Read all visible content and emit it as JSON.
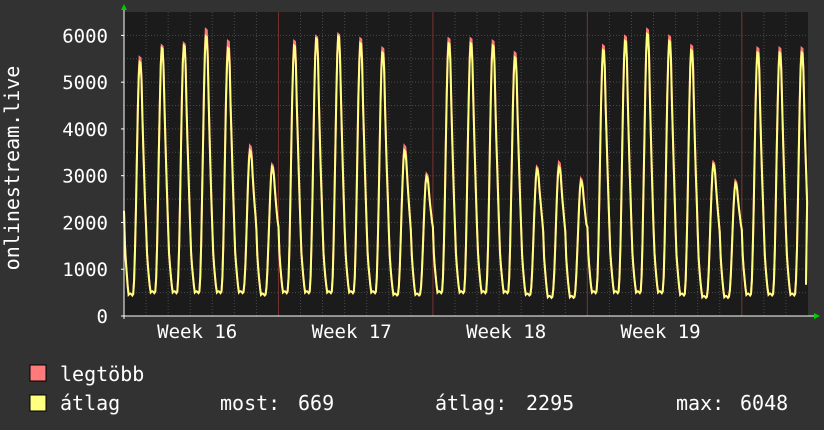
{
  "chart_data": {
    "type": "line",
    "ylabel": "onlinestream.live",
    "ylim": [
      0,
      6500
    ],
    "yticks": [
      0,
      1000,
      2000,
      3000,
      4000,
      5000,
      6000
    ],
    "week_labels": [
      "Week 16",
      "Week 17",
      "Week 18",
      "Week 19"
    ],
    "grid": true,
    "days": 31,
    "daily_peaks_max": [
      5550,
      5800,
      5850,
      6150,
      5900,
      3650,
      3250,
      5900,
      6000,
      6050,
      5950,
      5750,
      3650,
      3050,
      5950,
      5950,
      5900,
      5650,
      3200,
      3300,
      2950,
      5800,
      6000,
      6150,
      6000,
      5800,
      3300,
      2900,
      5750,
      5750
    ],
    "daily_peaks_avg": [
      5450,
      5750,
      5800,
      6000,
      5750,
      3550,
      3200,
      5800,
      5950,
      6000,
      5850,
      5650,
      3550,
      3000,
      5850,
      5850,
      5800,
      5550,
      3150,
      3200,
      2900,
      5700,
      5900,
      6050,
      5900,
      5700,
      3250,
      2850,
      5650,
      5650
    ],
    "daily_troughs": [
      450,
      500,
      500,
      500,
      500,
      500,
      450,
      500,
      500,
      500,
      500,
      500,
      450,
      450,
      500,
      500,
      500,
      500,
      450,
      400,
      400,
      500,
      500,
      500,
      500,
      450,
      400,
      400,
      450,
      450
    ],
    "start_value": 2250,
    "series": [
      {
        "name": "legtöbb",
        "color": "#ff7b7b"
      },
      {
        "name": "átlag",
        "color": "#ffff80"
      }
    ],
    "stats": {
      "most_label": "most:",
      "most_value": "669",
      "atlag_label": "átlag:",
      "atlag_value": "2295",
      "max_label": "max:",
      "max_value": "6048"
    }
  }
}
